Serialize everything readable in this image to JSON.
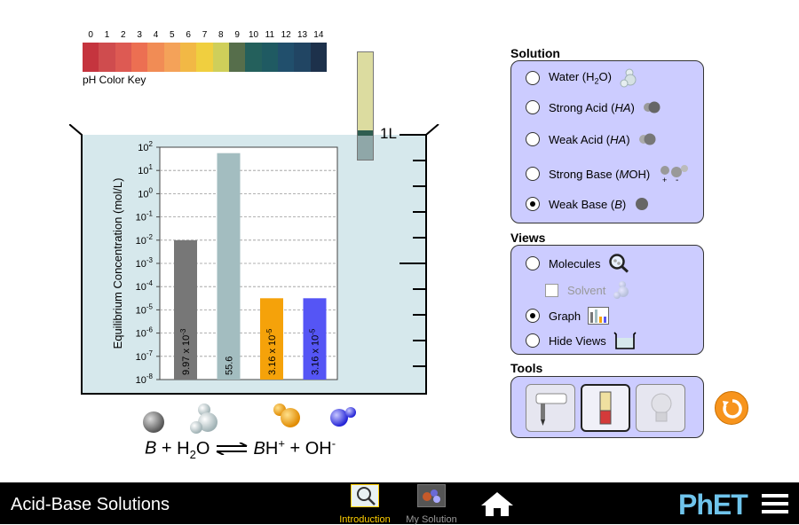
{
  "ph_key": {
    "label": "pH Color Key",
    "numbers": [
      "0",
      "1",
      "2",
      "3",
      "4",
      "5",
      "6",
      "7",
      "8",
      "9",
      "10",
      "11",
      "12",
      "13",
      "14"
    ],
    "colors": [
      "#c5343e",
      "#cf4c4e",
      "#dd5a53",
      "#ec6f52",
      "#f18c55",
      "#f4a259",
      "#f2b845",
      "#f0cf3f",
      "#cfcf5a",
      "#566e4b",
      "#24605c",
      "#1f5a62",
      "#214f6c",
      "#214563",
      "#1d314b"
    ]
  },
  "beaker": {
    "volume_label": "1L"
  },
  "chart_data": {
    "type": "bar",
    "ylabel": "Equilibrium Concentration (mol/L)",
    "yscale": "log",
    "ylim": [
      1e-08,
      100
    ],
    "y_ticks": [
      {
        "base": "10",
        "exp": "2"
      },
      {
        "base": "10",
        "exp": "1"
      },
      {
        "base": "10",
        "exp": "0"
      },
      {
        "base": "10",
        "exp": "-1"
      },
      {
        "base": "10",
        "exp": "-2"
      },
      {
        "base": "10",
        "exp": "-3"
      },
      {
        "base": "10",
        "exp": "-4"
      },
      {
        "base": "10",
        "exp": "-5"
      },
      {
        "base": "10",
        "exp": "-6"
      },
      {
        "base": "10",
        "exp": "-7"
      },
      {
        "base": "10",
        "exp": "-8"
      }
    ],
    "grid": true,
    "bars": [
      {
        "value": 0.00997,
        "label": "9.97 x 10",
        "label_exp": "-3",
        "color": "#777777"
      },
      {
        "value": 55.6,
        "label": "55.6",
        "label_exp": "",
        "color": "#a3bdc0"
      },
      {
        "value": 3.16e-05,
        "label": "3.16 x 10",
        "label_exp": "-5",
        "color": "#f5a20a"
      },
      {
        "value": 3.16e-05,
        "label": "3.16 x 10",
        "label_exp": "-5",
        "color": "#5555f5"
      }
    ]
  },
  "equation": {
    "reactant": "B",
    "plus1": "+",
    "water": "H",
    "water_sub": "2",
    "water_tail": "O",
    "products": "BH",
    "product_sup": "+",
    "plus2": "+",
    "hydroxide": "OH",
    "hydroxide_sup": "-"
  },
  "solution": {
    "title": "Solution",
    "options": [
      {
        "pre": "Water (H",
        "sub": "2",
        "post": "O)",
        "italic": "",
        "tail": "",
        "selected": false
      },
      {
        "pre": "Strong Acid (",
        "sub": "",
        "post": "",
        "italic": "HA",
        "tail": ")",
        "selected": false
      },
      {
        "pre": "Weak Acid (",
        "sub": "",
        "post": "",
        "italic": "HA",
        "tail": ")",
        "selected": false
      },
      {
        "pre": "Strong Base (",
        "sub": "",
        "post": "",
        "italic": "M",
        "tail": "OH)",
        "selected": false
      },
      {
        "pre": "Weak Base (",
        "sub": "",
        "post": "",
        "italic": "B",
        "tail": ")",
        "selected": true
      }
    ]
  },
  "views": {
    "title": "Views",
    "molecules": "Molecules",
    "solvent": "Solvent",
    "graph": "Graph",
    "hide": "Hide Views",
    "selected": "graph"
  },
  "tools": {
    "title": "Tools",
    "selected": "ph-paper"
  },
  "navbar": {
    "app_title": "Acid-Base Solutions",
    "screens": [
      {
        "label": "Introduction",
        "active": true,
        "color": "#ffd000"
      },
      {
        "label": "My Solution",
        "active": false,
        "color": "#9a9a9a"
      }
    ],
    "brand": "PhET"
  },
  "colors": {
    "panel": "#ccccff",
    "water": "#d6e8ec",
    "accent": "#f7941d"
  }
}
